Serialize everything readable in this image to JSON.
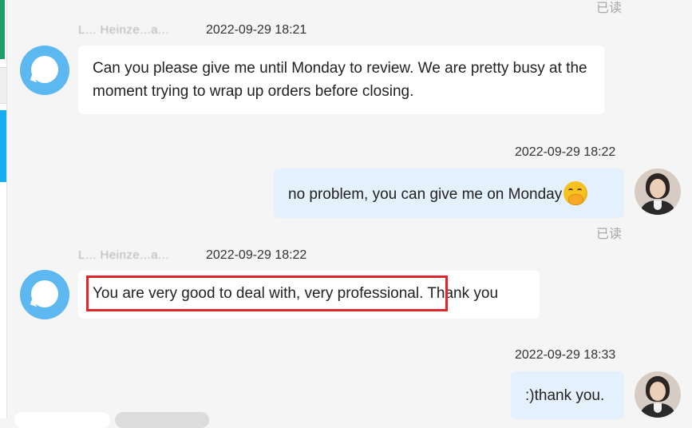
{
  "messages": [
    {
      "direction": "in",
      "sender": "L... Heinze...a...",
      "timestamp": "2022-09-29 18:21",
      "text": "Can you please give me until Monday to review. We are pretty busy at the moment trying to wrap up orders before closing."
    },
    {
      "direction": "out",
      "timestamp": "2022-09-29 18:22",
      "text": "no problem, you can give me on Monday",
      "emoji": "face-with-hand-over-mouth",
      "read_status": "已读"
    },
    {
      "direction": "in",
      "sender": "L... Heinze...a...",
      "timestamp": "2022-09-29 18:22",
      "text": "You are very good to deal with, very professional. Thank you",
      "highlighted_text": "You are very good to deal with, very professional."
    },
    {
      "direction": "out",
      "timestamp": "2022-09-29 18:33",
      "text": ":)thank you."
    }
  ],
  "top_read_status": "已读",
  "colors": {
    "incoming_bubble": "#ffffff",
    "outgoing_bubble": "#e4f0fc",
    "highlight_border": "#e0262a",
    "bot_avatar": "#5db8f2"
  }
}
